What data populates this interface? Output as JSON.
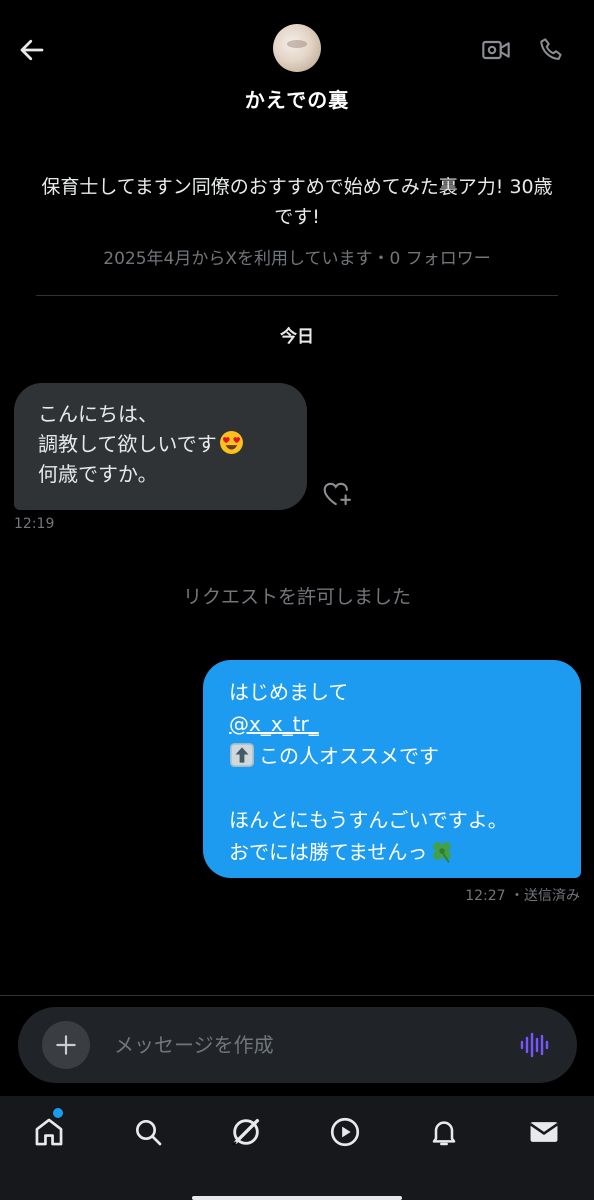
{
  "header": {
    "title": "かえでの裏",
    "back_icon": "arrow-left-icon",
    "video_icon": "video-camera-icon",
    "phone_icon": "phone-icon"
  },
  "profile": {
    "bio": "保育士してますン同僚のおすすめで始めてみた裏ア力! 30歳です!",
    "meta": "2025年4月からXを利用しています・0 フォロワー"
  },
  "conversation": {
    "day_label": "今日",
    "received": {
      "lines": [
        "こんにちは、",
        "調教して欲しいです",
        "何歳ですか。"
      ],
      "time": "12:19"
    },
    "system_message": "リクエストを許可しました",
    "sent": {
      "line1": "はじめまして",
      "mention": "@x_x_tr_",
      "line3": "この人オススメです",
      "line4": "",
      "line5": "ほんとにもうすんごいですよ。",
      "line6": "おでには勝てませんっ",
      "time": "12:27",
      "status": "・送信済み"
    }
  },
  "composer": {
    "placeholder": "メッセージを作成"
  },
  "colors": {
    "accent": "#1d9bf0",
    "voice": "#7856ff",
    "bubble_in": "#2f3336",
    "muted": "#71767b"
  }
}
